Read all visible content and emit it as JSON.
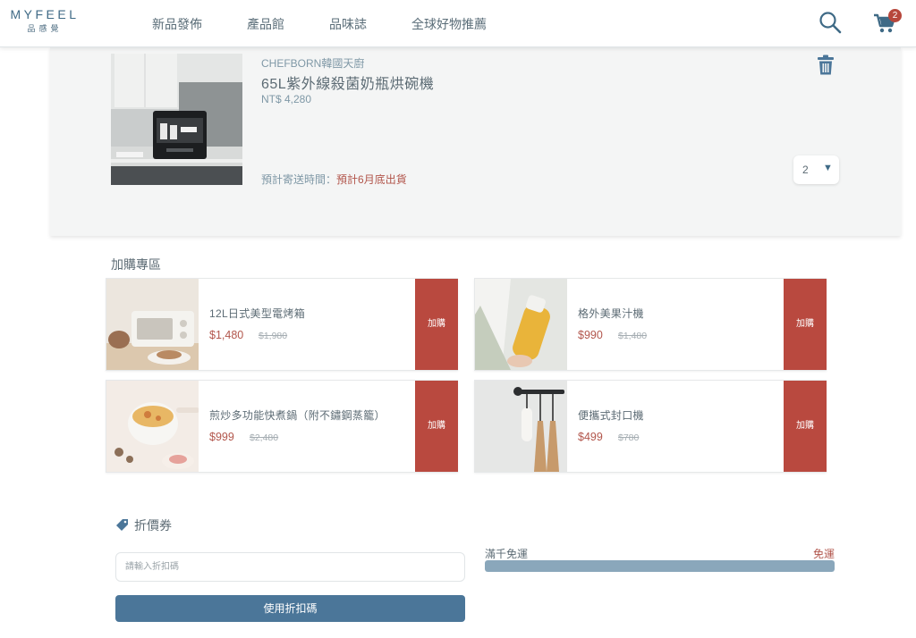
{
  "header": {
    "logo_main": "MYFEEL",
    "logo_sub": "品感覺",
    "nav": [
      "新品發佈",
      "產品館",
      "品味誌",
      "全球好物推薦"
    ],
    "cart_count": "2"
  },
  "cart_item": {
    "brand": "CHEFBORN韓國天廚",
    "name": "65L紫外線殺菌奶瓶烘碗機",
    "price": "NT$ 4,280",
    "ship_label": "預計寄送時間：",
    "ship_value": "預計6月底出貨",
    "qty": "2"
  },
  "addons": {
    "title": "加購專區",
    "button_label": "加購",
    "items": [
      {
        "name": "12L日式美型電烤箱",
        "price": "$1,480",
        "orig": "$1,980"
      },
      {
        "name": "格外美果汁機",
        "price": "$990",
        "orig": "$1,480"
      },
      {
        "name": "煎炒多功能快煮鍋（附不鏽鋼蒸籠）",
        "price": "$999",
        "orig": "$2,480"
      },
      {
        "name": "便攜式封口機",
        "price": "$499",
        "orig": "$780"
      }
    ]
  },
  "coupon": {
    "title": "折價券",
    "placeholder": "請輸入折扣碼",
    "button": "使用折扣碼"
  },
  "shipping": {
    "label": "滿千免運",
    "status": "免運",
    "progress": 1.0
  },
  "colors": {
    "accent": "#b9493f",
    "primary": "#4b7699",
    "logo": "#3f6a86"
  }
}
